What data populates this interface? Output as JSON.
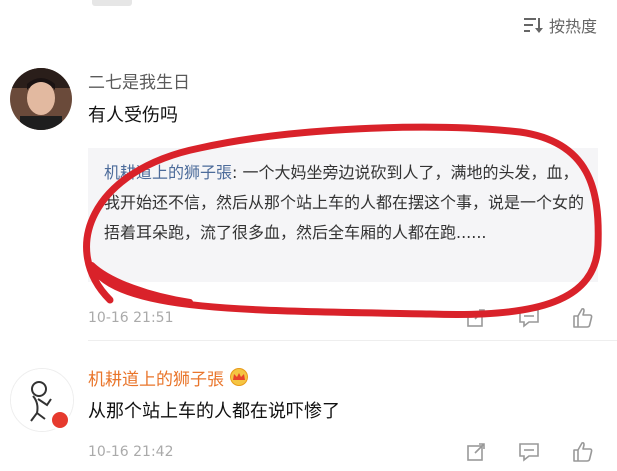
{
  "sort": {
    "label": "按热度",
    "icon": "sort-list-icon"
  },
  "comments": [
    {
      "author": "二七是我生日",
      "text": "有人受伤吗",
      "reply": {
        "author": "机耕道上的狮子張",
        "separator": ": ",
        "text": "一个大妈坐旁边说砍到人了，满地的头发，血，我开始还不信，然后从那个站上车的人都在摆这个事，说是一个女的捂着耳朵跑，流了很多血，然后全车厢的人都在跑......"
      },
      "time": "10-16 21:51"
    },
    {
      "author": "机耕道上的狮子張",
      "text": "从那个站上车的人都在说吓惨了",
      "time": "10-16 21:42"
    }
  ],
  "colors": {
    "author_name": "#5a5a5a",
    "vip_name": "#e9752b",
    "reply_name": "#4c6b9a",
    "annotation": "#d9222a",
    "badge": "#e63a2e"
  }
}
